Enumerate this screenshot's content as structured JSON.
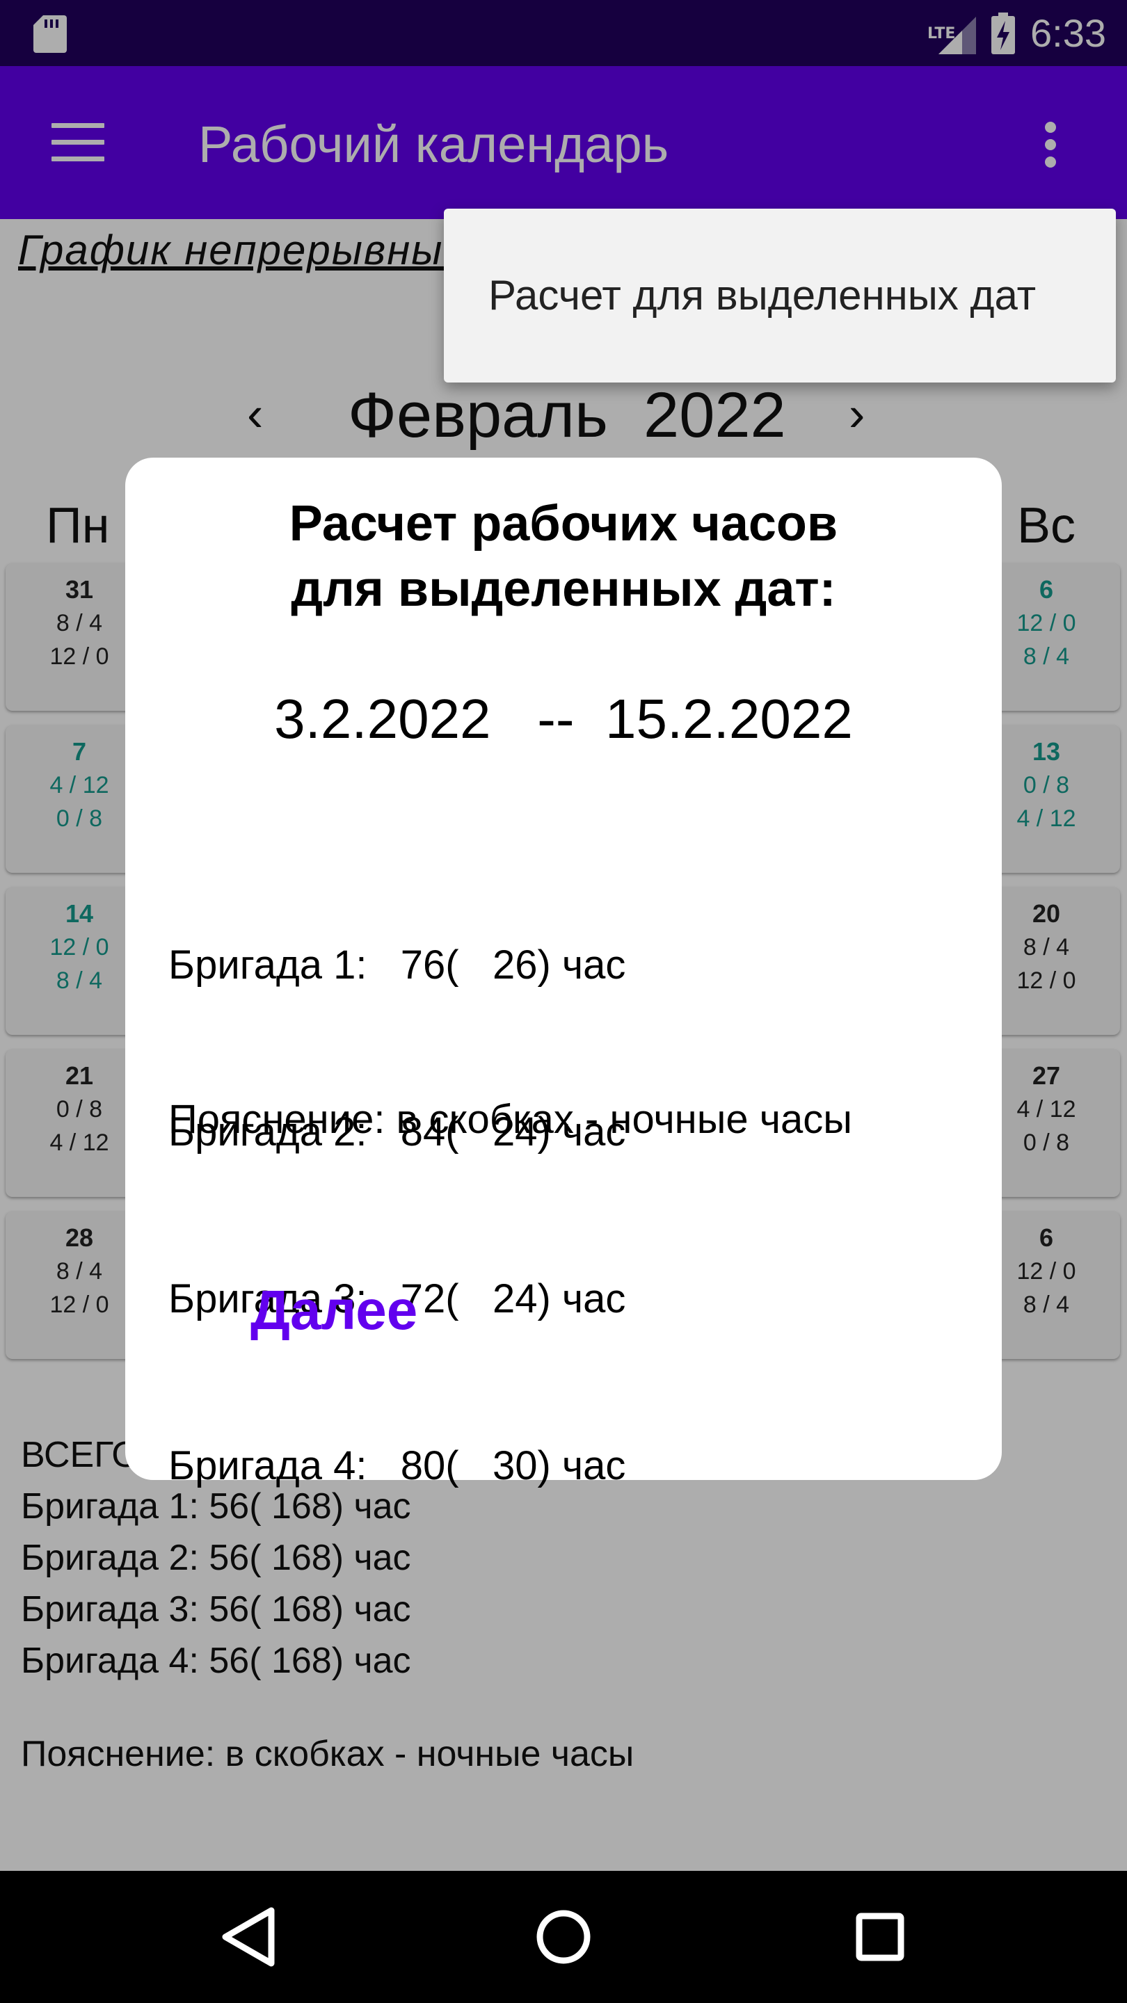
{
  "status_bar": {
    "network": "LTE",
    "time": "6:33"
  },
  "app_bar": {
    "title": "Рабочий календарь"
  },
  "content": {
    "schedule_title": "График непрерывный",
    "month_label": "Февраль  2022",
    "prev_arrow": "‹",
    "next_arrow": "›",
    "weekday_mon": "Пн",
    "weekday_sun": "Вс",
    "left_cells": [
      {
        "day": "31",
        "line1": "8 /  4",
        "line2": "12 /  0"
      },
      {
        "day": "7",
        "line1": "4 / 12",
        "line2": "0 /  8"
      },
      {
        "day": "14",
        "line1": "12 /  0",
        "line2": "8 /  4"
      },
      {
        "day": "21",
        "line1": "0 /  8",
        "line2": "4 / 12"
      },
      {
        "day": "28",
        "line1": "8 /  4",
        "line2": "12 /  0"
      }
    ],
    "right_cells": [
      {
        "day": "6",
        "line1": "12 /  0",
        "line2": "8 /  4"
      },
      {
        "day": "13",
        "line1": "0 /  8",
        "line2": "4 / 12"
      },
      {
        "day": "20",
        "line1": "8 /  4",
        "line2": "12 /  0"
      },
      {
        "day": "27",
        "line1": "4 / 12",
        "line2": "0 /  8"
      },
      {
        "day": "6",
        "line1": "12 /  0",
        "line2": "8 /  4"
      }
    ],
    "totals_header": "ВСЕГО:",
    "totals": [
      "Бригада 1:  56( 168) час",
      "Бригада 2:  56( 168) час",
      "Бригада 3:  56( 168) час",
      "Бригада 4:  56( 168) час"
    ],
    "totals_note": "Пояснение: в скобках - ночные часы"
  },
  "menu": {
    "item": "Расчет для выделенных дат"
  },
  "dialog": {
    "title_line1": "Расчет рабочих часов",
    "title_line2": "для выделенных дат:",
    "date_range": "3.2.2022   --  15.2.2022",
    "results": [
      "Бригада 1:   76(   26) час",
      "Бригада 2:   84(   24) час",
      "Бригада 3:   72(   24) час",
      "Бригада 4:   80(   30) час"
    ],
    "note": "Пояснение: в скобках - ночные часы",
    "next_button": "Далее"
  },
  "colors": {
    "status_bar": "#21005d",
    "app_bar": "#6200ee",
    "accent": "#6200ee",
    "weekend_text": "#159a8c"
  }
}
